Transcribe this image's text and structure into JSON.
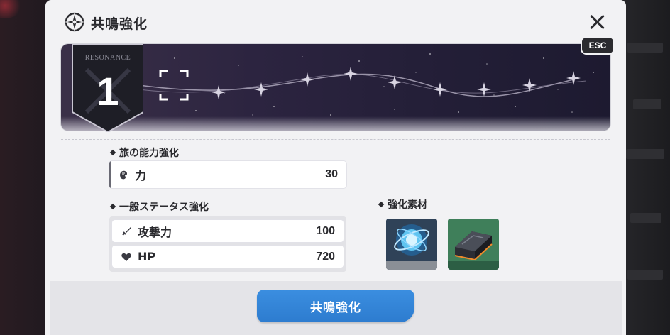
{
  "header": {
    "title": "共鳴強化",
    "esc_label": "ESC"
  },
  "resonance": {
    "label": "RESONANCE",
    "level": "1"
  },
  "travel_boost": {
    "section_label": "旅の能力強化",
    "stat": {
      "name": "力",
      "value": "30",
      "icon": "fist-icon"
    }
  },
  "general_status": {
    "section_label": "一般ステータス強化",
    "stats": [
      {
        "name": "攻撃力",
        "value": "100",
        "icon": "sword-icon"
      },
      {
        "name": "HP",
        "value": "720",
        "icon": "heart-icon"
      }
    ]
  },
  "materials": {
    "section_label": "強化素材",
    "items": [
      {
        "icon": "blue-orb-material-icon",
        "rarity_color": "#8a8f96"
      },
      {
        "icon": "dark-ingot-material-icon",
        "rarity_color": "#3f7f5a"
      }
    ]
  },
  "footer": {
    "confirm_label": "共鳴強化"
  },
  "colors": {
    "accent_button": "#3b8ee0",
    "panel_bg": "#f2f2f4",
    "text_dark": "#2a2a2e"
  }
}
